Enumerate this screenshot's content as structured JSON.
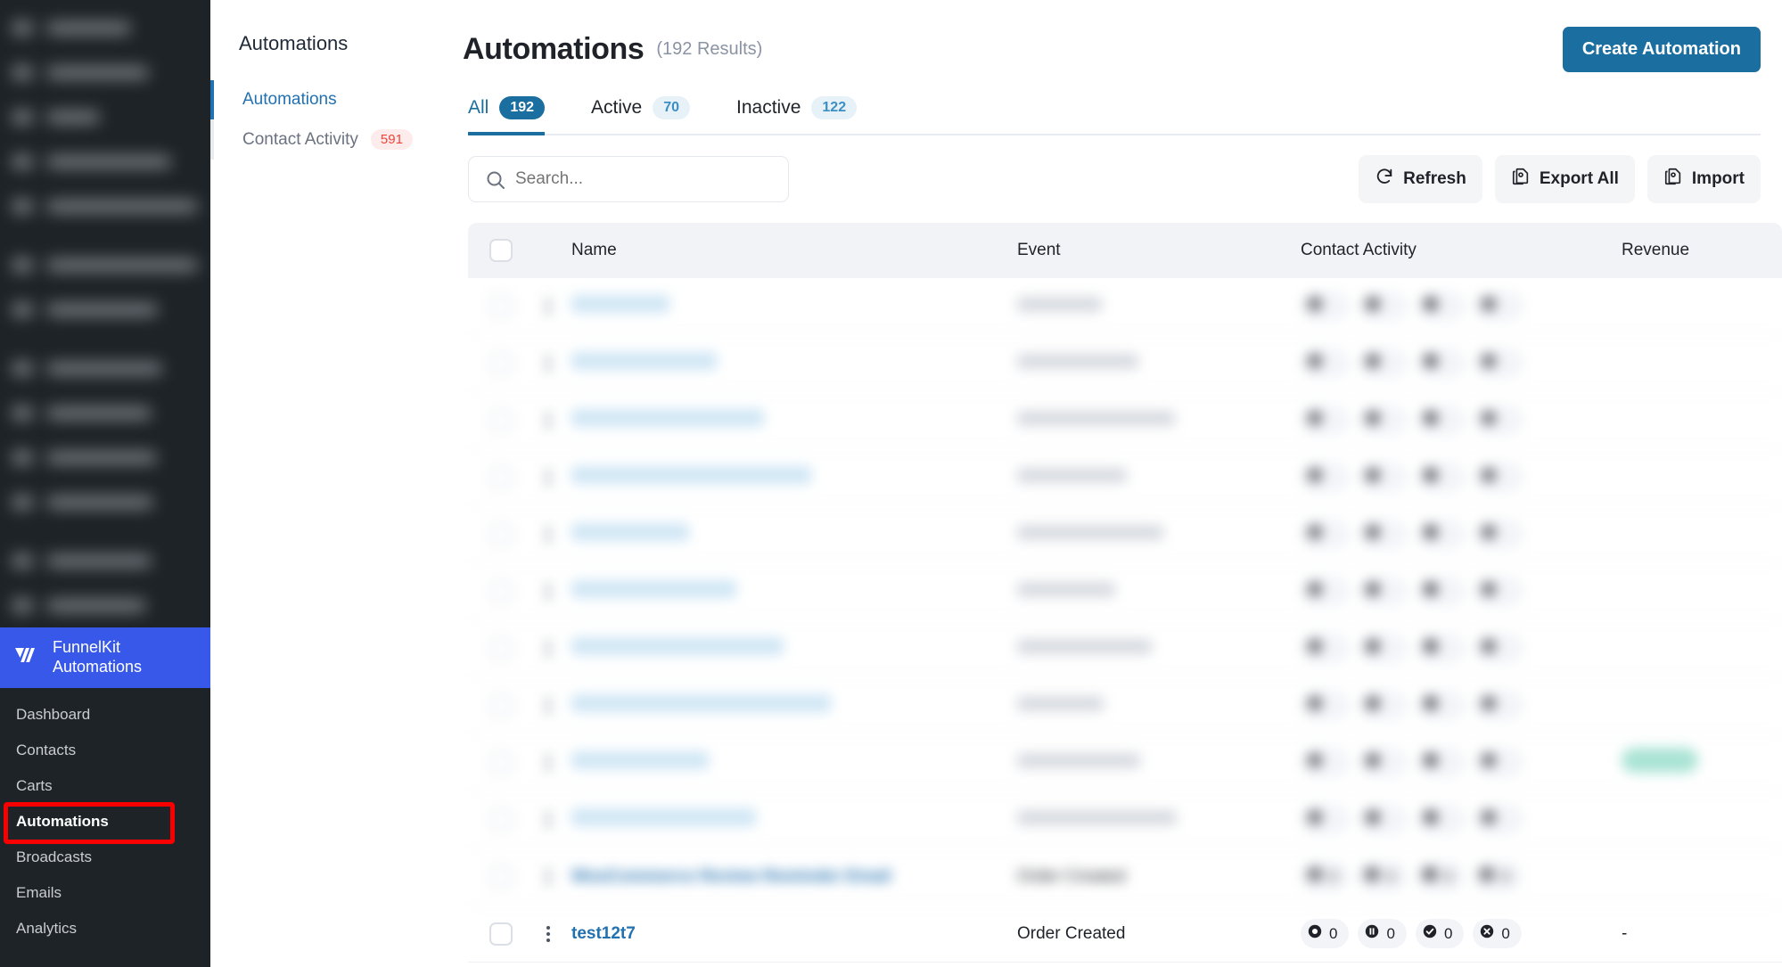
{
  "wp_sidebar": {
    "blurred_items_count": 13,
    "brand": {
      "name_line1": "FunnelKit",
      "name_line2": "Automations",
      "logo": "funnelkit-logo",
      "color": "#3858e9"
    },
    "menu": [
      {
        "label": "Dashboard",
        "active": false
      },
      {
        "label": "Contacts",
        "active": false
      },
      {
        "label": "Carts",
        "active": false
      },
      {
        "label": "Automations",
        "active": true
      },
      {
        "label": "Broadcasts",
        "active": false
      },
      {
        "label": "Emails",
        "active": false
      },
      {
        "label": "Analytics",
        "active": false
      }
    ],
    "highlight_color": "#f80000"
  },
  "sec_nav": {
    "title": "Automations",
    "items": [
      {
        "label": "Automations",
        "badge": "",
        "active": true
      },
      {
        "label": "Contact Activity",
        "badge": "591",
        "active": false
      }
    ],
    "badge_color": "#f04438",
    "active_color": "#2271b1"
  },
  "header": {
    "title": "Automations",
    "results": "(192 Results)",
    "create_button": "Create Automation",
    "create_button_color": "#1b6ea0"
  },
  "tabs": [
    {
      "label": "All",
      "count": "192",
      "active": true
    },
    {
      "label": "Active",
      "count": "70",
      "active": false
    },
    {
      "label": "Inactive",
      "count": "122",
      "active": false
    }
  ],
  "toolbar": {
    "search_placeholder": "Search...",
    "search_value": "",
    "refresh_label": "Refresh",
    "export_label": "Export All",
    "import_label": "Import"
  },
  "table": {
    "columns": [
      "Name",
      "Event",
      "Contact Activity",
      "Revenue"
    ],
    "rows": [
      {
        "name": "",
        "event": "",
        "activity": [
          "",
          "",
          "",
          ""
        ],
        "revenue": "",
        "blurred": true
      },
      {
        "name": "",
        "event": "",
        "activity": [
          "",
          "",
          "",
          ""
        ],
        "revenue": "",
        "blurred": true
      },
      {
        "name": "",
        "event": "",
        "activity": [
          "",
          "",
          "",
          ""
        ],
        "revenue": "",
        "blurred": true
      },
      {
        "name": "",
        "event": "",
        "activity": [
          "",
          "",
          "",
          ""
        ],
        "revenue": "",
        "blurred": true
      },
      {
        "name": "",
        "event": "",
        "activity": [
          "",
          "",
          "",
          ""
        ],
        "revenue": "",
        "blurred": true
      },
      {
        "name": "",
        "event": "",
        "activity": [
          "",
          "",
          "",
          ""
        ],
        "revenue": "",
        "blurred": true
      },
      {
        "name": "",
        "event": "",
        "activity": [
          "",
          "",
          "",
          ""
        ],
        "revenue": "",
        "blurred": true
      },
      {
        "name": "",
        "event": "",
        "activity": [
          "",
          "",
          "",
          ""
        ],
        "revenue": "",
        "blurred": true
      },
      {
        "name": "",
        "event": "",
        "activity": [
          "",
          "",
          "",
          ""
        ],
        "revenue": "revenue-badge",
        "blurred": true
      },
      {
        "name": "",
        "event": "",
        "activity": [
          "",
          "",
          "",
          ""
        ],
        "revenue": "",
        "blurred": true
      },
      {
        "name": "WooCommerce Review Reminder Email",
        "event": "Order Created",
        "activity": [
          "0",
          "0",
          "0",
          "0"
        ],
        "revenue": "",
        "blurred": true
      },
      {
        "name": "test12t7",
        "event": "Order Created",
        "activity": [
          "0",
          "0",
          "0",
          "0"
        ],
        "revenue": "-",
        "blurred": false
      }
    ],
    "activity_icons": [
      "active-circle-icon",
      "paused-icon",
      "completed-check-icon",
      "cancelled-x-icon"
    ]
  }
}
